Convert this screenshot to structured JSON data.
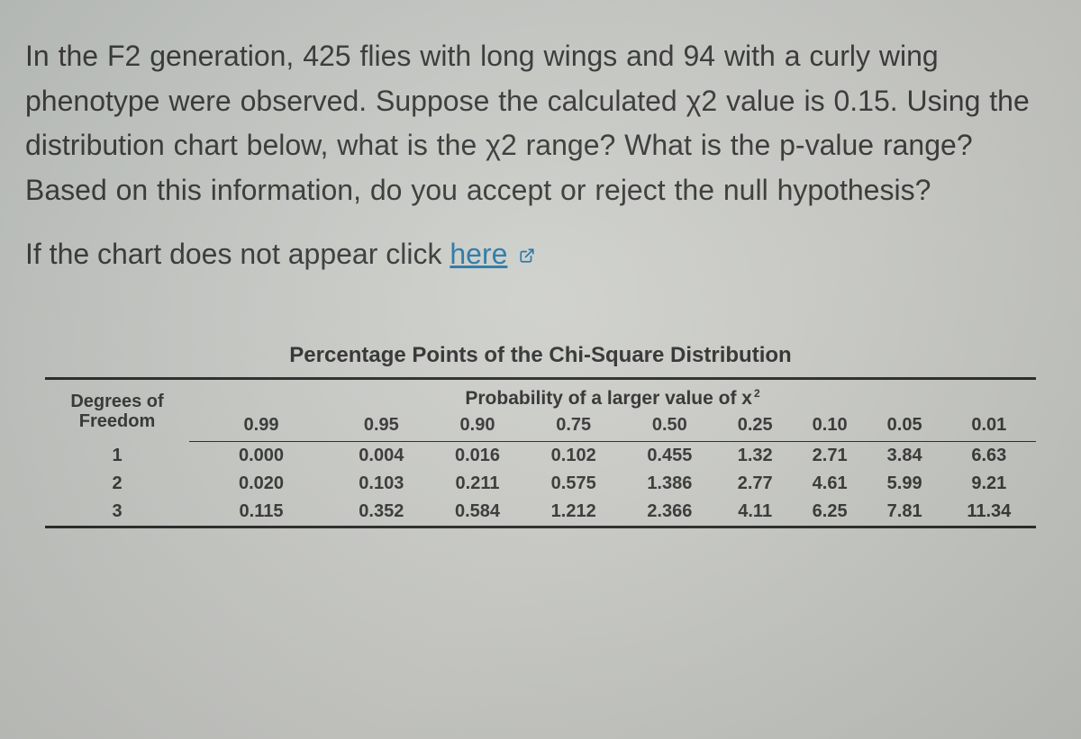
{
  "question_html": "In the F2 generation, 425 flies with long wings and 94 with a curly wing phenotype were observed. Suppose the calculated χ2 value is 0.15. Using the distribution chart below, what is the χ2 range? What is the p-value range? Based on this information, do you accept or reject the null hypothesis?",
  "chart_note_prefix": "If the chart does not appear click ",
  "chart_note_link": "here",
  "table": {
    "caption": "Percentage Points of the Chi-Square Distribution",
    "dof_label_line1": "Degrees of",
    "dof_label_line2": "Freedom",
    "spanner": "Probability of a larger value of x",
    "spanner_sup": "2",
    "p_headers": [
      "0.99",
      "0.95",
      "0.90",
      "0.75",
      "0.50",
      "0.25",
      "0.10",
      "0.05",
      "0.01"
    ],
    "rows": [
      {
        "df": "1",
        "v": [
          "0.000",
          "0.004",
          "0.016",
          "0.102",
          "0.455",
          "1.32",
          "2.71",
          "3.84",
          "6.63"
        ]
      },
      {
        "df": "2",
        "v": [
          "0.020",
          "0.103",
          "0.211",
          "0.575",
          "1.386",
          "2.77",
          "4.61",
          "5.99",
          "9.21"
        ]
      },
      {
        "df": "3",
        "v": [
          "0.115",
          "0.352",
          "0.584",
          "1.212",
          "2.366",
          "4.11",
          "6.25",
          "7.81",
          "11.34"
        ]
      }
    ]
  },
  "chart_data": {
    "type": "table",
    "title": "Percentage Points of the Chi-Square Distribution",
    "columns": [
      "Degrees of Freedom",
      "0.99",
      "0.95",
      "0.90",
      "0.75",
      "0.50",
      "0.25",
      "0.10",
      "0.05",
      "0.01"
    ],
    "rows": [
      [
        "1",
        0.0,
        0.004,
        0.016,
        0.102,
        0.455,
        1.32,
        2.71,
        3.84,
        6.63
      ],
      [
        "2",
        0.02,
        0.103,
        0.211,
        0.575,
        1.386,
        2.77,
        4.61,
        5.99,
        9.21
      ],
      [
        "3",
        0.115,
        0.352,
        0.584,
        1.212,
        2.366,
        4.11,
        6.25,
        7.81,
        11.34
      ]
    ]
  }
}
